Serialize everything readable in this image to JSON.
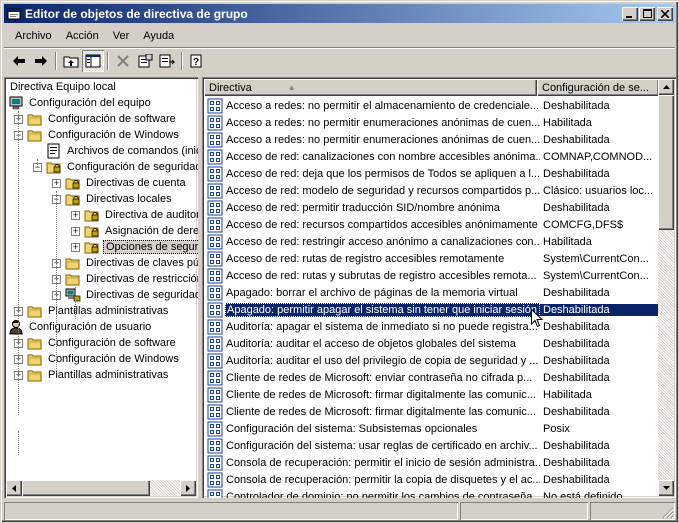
{
  "window": {
    "title": "Editor de objetos de directiva de grupo"
  },
  "menu": [
    "Archivo",
    "Acción",
    "Ver",
    "Ayuda"
  ],
  "toolbar": {
    "icons": [
      "back-arrow-icon",
      "forward-arrow-icon",
      "up-folder-icon",
      "show-tree-icon",
      "delete-icon",
      "properties-icon",
      "export-list-icon",
      "help-icon"
    ]
  },
  "tree": {
    "root": "Directiva Equipo local",
    "nodes": [
      {
        "label": "Configuración del equipo",
        "level": 0,
        "expander": "-",
        "icon": "computer-icon"
      },
      {
        "label": "Configuración de software",
        "level": 1,
        "expander": "+",
        "icon": "folder-icon"
      },
      {
        "label": "Configuración de Windows",
        "level": 1,
        "expander": "-",
        "icon": "folder-icon"
      },
      {
        "label": "Archivos de comandos (inic",
        "level": 2,
        "expander": "",
        "icon": "script-icon"
      },
      {
        "label": "Configuración de seguridad",
        "level": 2,
        "expander": "-",
        "icon": "security-folder-icon"
      },
      {
        "label": "Directivas de cuenta",
        "level": 3,
        "expander": "+",
        "icon": "security-folder-icon"
      },
      {
        "label": "Directivas locales",
        "level": 3,
        "expander": "-",
        "icon": "security-folder-icon"
      },
      {
        "label": "Directiva de auditor",
        "level": 4,
        "expander": "+",
        "icon": "security-folder-icon"
      },
      {
        "label": "Asignación de dere",
        "level": 4,
        "expander": "+",
        "icon": "security-folder-icon"
      },
      {
        "label": "Opciones de seguri",
        "level": 4,
        "expander": "+",
        "icon": "security-folder-icon",
        "selected": true
      },
      {
        "label": "Directivas de claves pú",
        "level": 3,
        "expander": "+",
        "icon": "folder-icon"
      },
      {
        "label": "Directivas de restricciór",
        "level": 3,
        "expander": "+",
        "icon": "folder-icon"
      },
      {
        "label": "Directivas de seguridad",
        "level": 3,
        "expander": "+",
        "icon": "network-security-icon"
      },
      {
        "label": "Plantillas administrativas",
        "level": 1,
        "expander": "+",
        "icon": "folder-icon"
      },
      {
        "label": "Configuración de usuario",
        "level": 0,
        "expander": "-",
        "icon": "user-icon"
      },
      {
        "label": "Configuración de software",
        "level": 1,
        "expander": "+",
        "icon": "folder-icon"
      },
      {
        "label": "Configuración de Windows",
        "level": 1,
        "expander": "+",
        "icon": "folder-icon"
      },
      {
        "label": "Plantillas administrativas",
        "level": 1,
        "expander": "+",
        "icon": "folder-icon"
      }
    ]
  },
  "list": {
    "columns": [
      "Directiva",
      "Configuración de se..."
    ],
    "sort_indicator": "▲",
    "rows": [
      {
        "policy": "Acceso a redes: no permitir el almacenamiento de  credenciale...",
        "setting": "Deshabilitada"
      },
      {
        "policy": "Acceso a redes: no permitir enumeraciones anónimas de cuen...",
        "setting": "Habilitada"
      },
      {
        "policy": "Acceso a redes: no permitir enumeraciones anónimas de cuen...",
        "setting": "Deshabilitada"
      },
      {
        "policy": "Acceso de red: canalizaciones con nombre accesibles anónima...",
        "setting": "COMNAP,COMNOD..."
      },
      {
        "policy": "Acceso de red: deja que los permisos de Todos se apliquen a l...",
        "setting": "Deshabilitada"
      },
      {
        "policy": "Acceso de red: modelo de seguridad y recursos compartidos p...",
        "setting": "Clásico: usuarios loc..."
      },
      {
        "policy": "Acceso de red: permitir traducción SID/nombre anónima",
        "setting": "Deshabilitada"
      },
      {
        "policy": "Acceso de red: recursos compartidos accesibles anónimamente",
        "setting": "COMCFG,DFS$"
      },
      {
        "policy": "Acceso de red: restringir acceso anónimo a canalizaciones con...",
        "setting": "Habilitada"
      },
      {
        "policy": "Acceso de red: rutas de registro accesibles remotamente",
        "setting": "System\\CurrentCon..."
      },
      {
        "policy": "Acceso de red: rutas y subrutas de registro accesibles remota...",
        "setting": "System\\CurrentCon..."
      },
      {
        "policy": "Apagado: borrar el archivo de páginas de la memoria virtual",
        "setting": "Deshabilitada"
      },
      {
        "policy": "Apagado: permitir apagar el sistema sin tener que iniciar sesión",
        "setting": "Deshabilitada",
        "selected": true
      },
      {
        "policy": "Auditoría: apagar el sistema de inmediato si no puede registra...",
        "setting": "Deshabilitada"
      },
      {
        "policy": "Auditoría: auditar el acceso de objetos globales del sistema",
        "setting": "Deshabilitada"
      },
      {
        "policy": "Auditoría: auditar el uso del privilegio de copia de seguridad y ...",
        "setting": "Deshabilitada"
      },
      {
        "policy": "Cliente de redes de Microsoft: enviar contraseña no cifrada p...",
        "setting": "Deshabilitada"
      },
      {
        "policy": "Cliente de redes de Microsoft: firmar digitalmente las comunic...",
        "setting": "Habilitada"
      },
      {
        "policy": "Cliente de redes de Microsoft: firmar digitalmente las comunic...",
        "setting": "Deshabilitada"
      },
      {
        "policy": "Configuración del sistema: Subsistemas opcionales",
        "setting": "Posix"
      },
      {
        "policy": "Configuración del sistema: usar reglas de certificado en archiv...",
        "setting": "Deshabilitada"
      },
      {
        "policy": "Consola de recuperación: permitir el inicio de sesión administra...",
        "setting": "Deshabilitada"
      },
      {
        "policy": "Consola de recuperación: permitir la copia de disquetes y el ac...",
        "setting": "Deshabilitada"
      },
      {
        "policy": "Controlador de dominio: no permitir los cambios de contraseña...",
        "setting": "No está definido"
      }
    ]
  },
  "colors": {
    "titlebar_start": "#0a246a",
    "titlebar_end": "#a6caf0",
    "selection": "#0a246a",
    "face": "#d4d0c8"
  }
}
